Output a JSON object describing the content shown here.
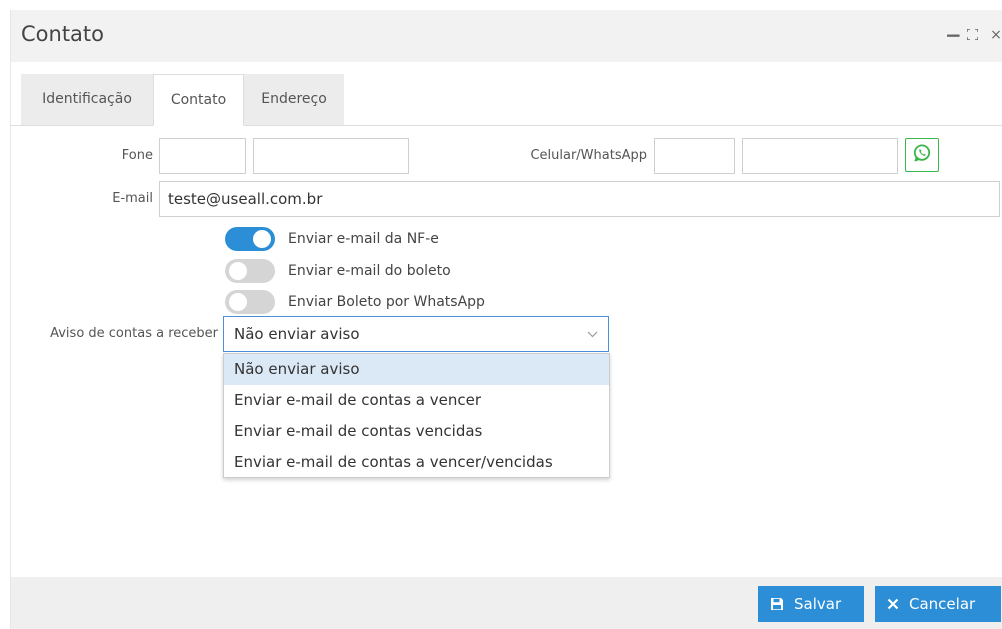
{
  "window": {
    "title": "Contato",
    "controls": {
      "minimize": "−",
      "close": "×"
    }
  },
  "tabs": [
    {
      "label": "Identificação",
      "active": false
    },
    {
      "label": "Contato",
      "active": true
    },
    {
      "label": "Endereço",
      "active": false
    }
  ],
  "form": {
    "fone_label": "Fone",
    "fone_ddd": "",
    "fone_number": "",
    "celular_label": "Celular/WhatsApp",
    "celular_ddd": "",
    "celular_number": "",
    "email_label": "E-mail",
    "email_value": "teste@useall.com.br",
    "toggles": [
      {
        "label": "Enviar e-mail da NF-e",
        "on": true
      },
      {
        "label": "Enviar e-mail do boleto",
        "on": false
      },
      {
        "label": "Enviar Boleto por WhatsApp",
        "on": false
      }
    ],
    "aviso_label": "Aviso de contas a receber",
    "aviso_selected": "Não enviar aviso",
    "aviso_options": [
      "Não enviar aviso",
      "Enviar e-mail de contas a vencer",
      "Enviar e-mail de contas vencidas",
      "Enviar e-mail de contas a vencer/vencidas"
    ]
  },
  "footer": {
    "save_label": "Salvar",
    "cancel_label": "Cancelar"
  },
  "colors": {
    "accent": "#2b8ed6",
    "whatsapp": "#39b54a",
    "toggle_off": "#d5d5d5",
    "option_highlight": "#dbe9f6"
  },
  "icons": {
    "minimize": "minimize-icon",
    "maximize": "maximize-icon",
    "close": "close-icon",
    "whatsapp": "whatsapp-icon",
    "save": "floppy-disk-icon",
    "cancel": "x-icon",
    "dropdown": "chevron-down-icon"
  }
}
